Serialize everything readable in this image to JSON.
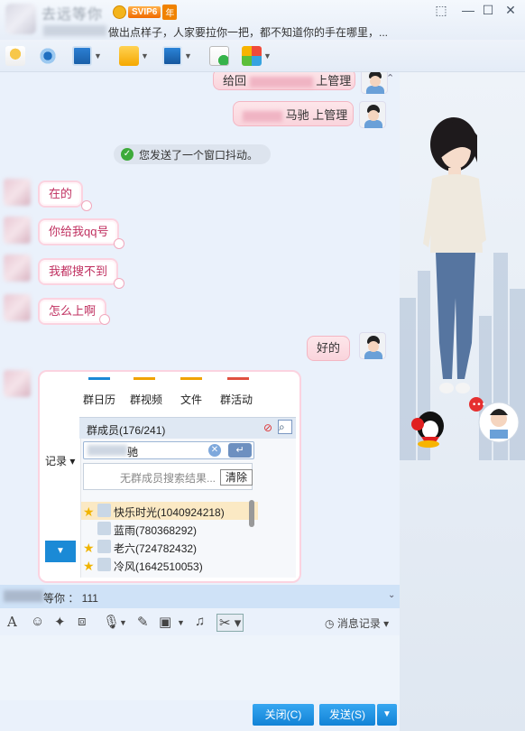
{
  "window": {
    "vip_badge": "SVIP6",
    "vip_year": "年",
    "signature": "做出点样子，人家要拉你一把，都不知道你的手在哪里，...",
    "min_glyph": "—",
    "restore_glyph": "❐",
    "max_glyph": "☐",
    "close_glyph": "✕"
  },
  "messages": {
    "out1": "给回",
    "out1_suffix": "上管理",
    "out2": "马驰 上管理",
    "system": "您发送了一个窗口抖动。",
    "in1": "在的",
    "in2": "你给我qq号",
    "in3": "我都搜不到",
    "in4": "怎么上啊",
    "out3": "好的"
  },
  "screenshot": {
    "tabs": [
      "群日历",
      "群视频",
      "文件",
      "群活动"
    ],
    "tab_colors": [
      "#1b8ad6",
      "#f0a300",
      "#f0a300",
      "#e05040"
    ],
    "members_header": "群成员(176/241)",
    "search_partial": "驰",
    "no_result": "无群成员搜索结果...",
    "clear_label": "清除",
    "side_label": "记录",
    "members": [
      "快乐时光(1040924218)",
      "蓝雨(780368292)",
      "老六(724782432)",
      "冷风(1642510053)"
    ]
  },
  "notice": {
    "text": "等你 ： 111"
  },
  "input": {
    "history_label": "消息记录"
  },
  "buttons": {
    "close_label": "关闭(C)",
    "send_label": "发送(S)"
  }
}
